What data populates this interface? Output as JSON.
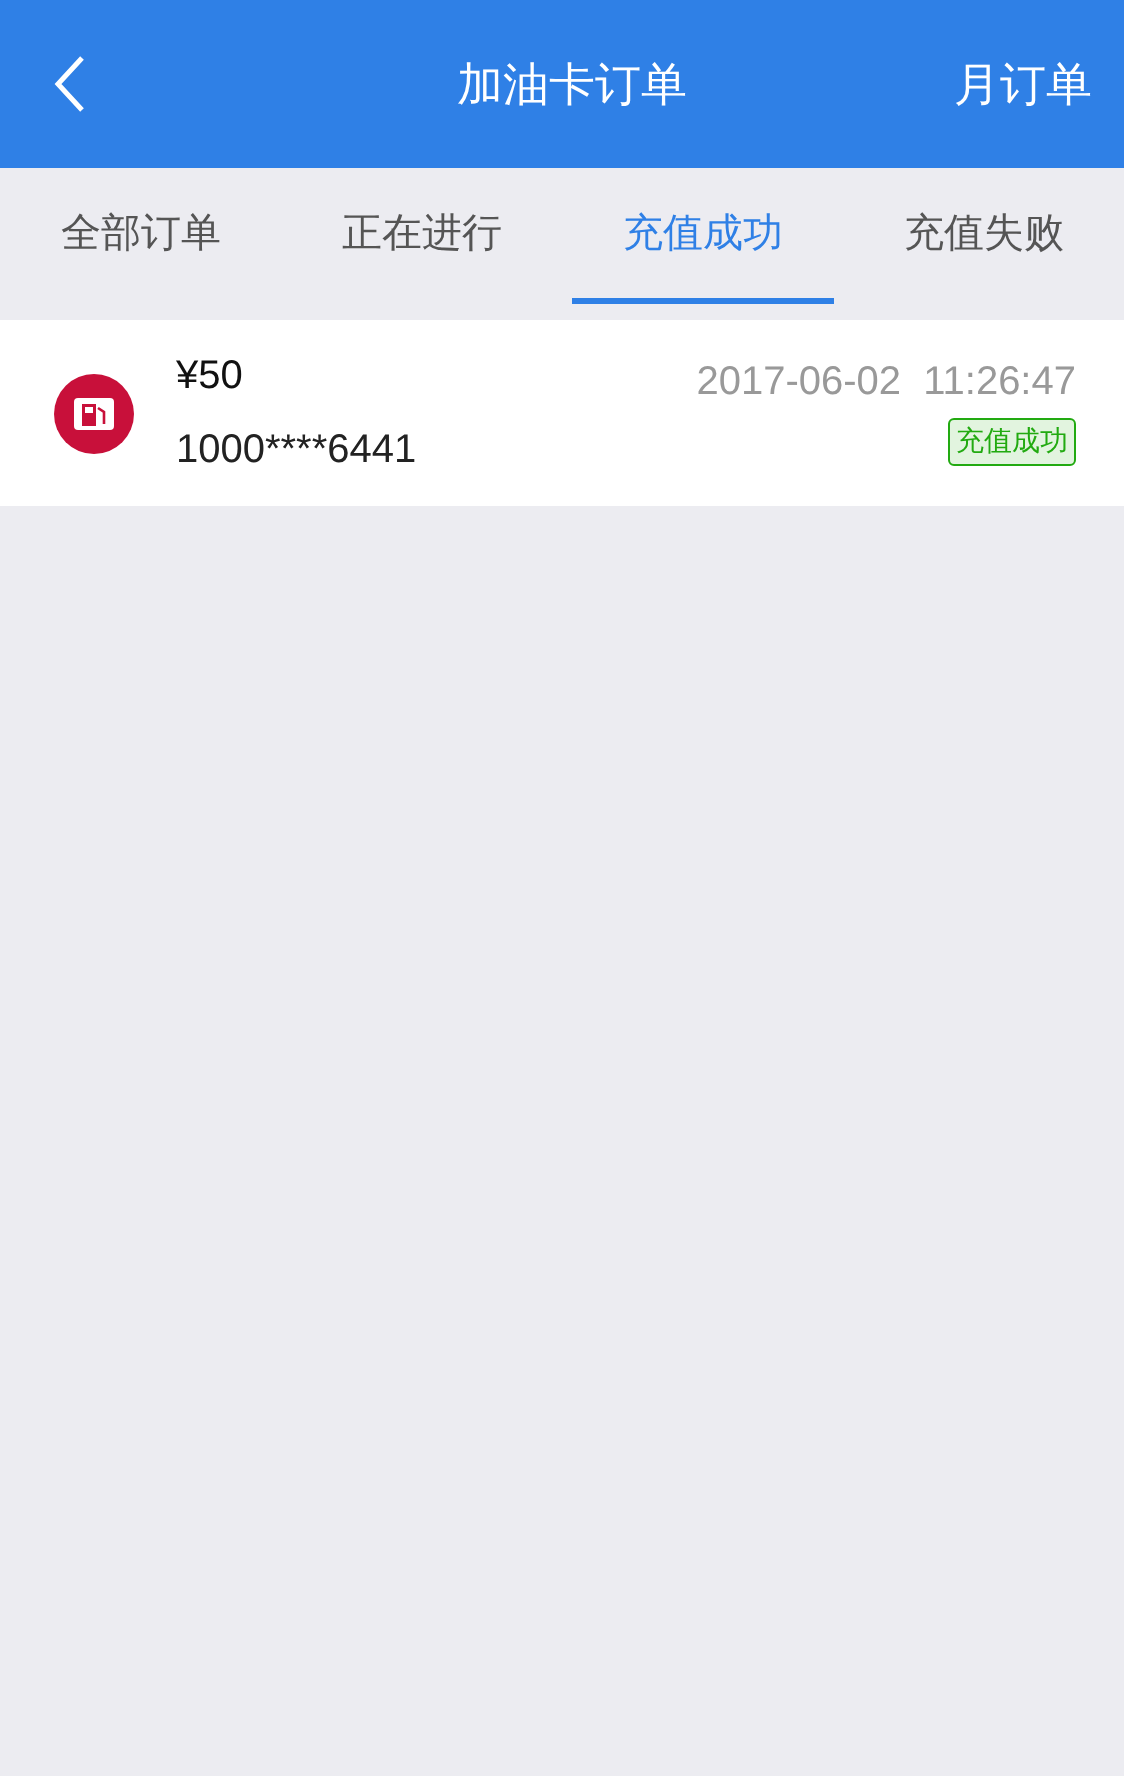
{
  "header": {
    "title": "加油卡订单",
    "action": "月订单"
  },
  "tabs": [
    {
      "label": "全部订单",
      "selected": false
    },
    {
      "label": "正在进行",
      "selected": false
    },
    {
      "label": "充值成功",
      "selected": true
    },
    {
      "label": "充值失败",
      "selected": false
    }
  ],
  "orders": [
    {
      "amount": "¥50",
      "card": "1000****6441",
      "time": "2017-06-02  11:26:47",
      "status": "充值成功",
      "color": "#22aa11"
    }
  ]
}
